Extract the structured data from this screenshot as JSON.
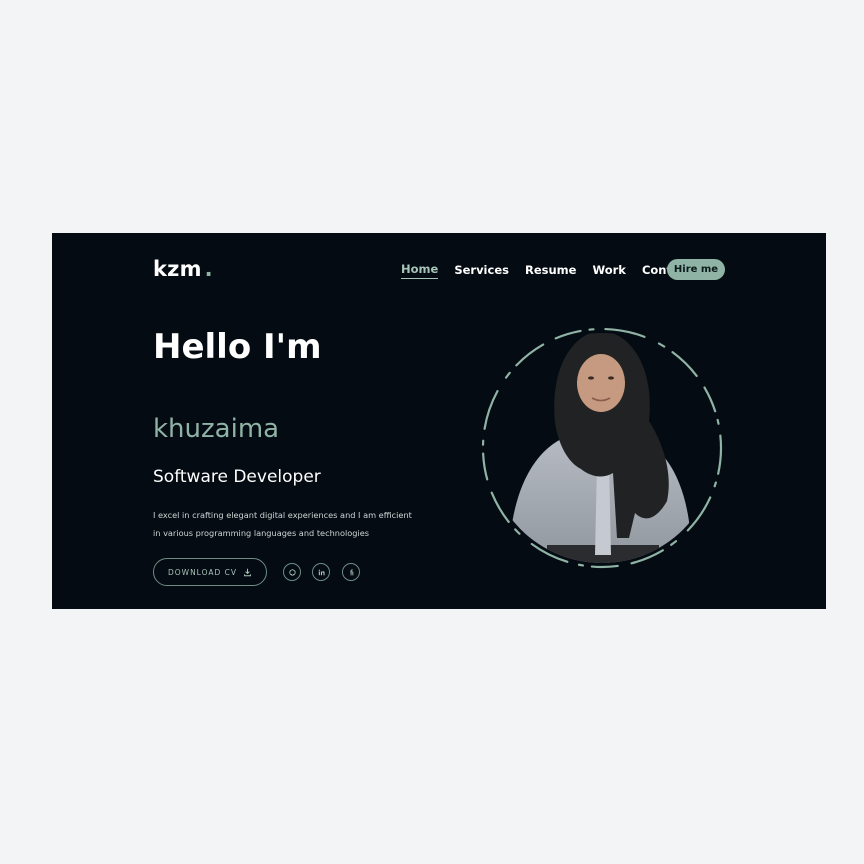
{
  "header": {
    "logo": "kzm",
    "logo_dot": ".",
    "nav": [
      "Home",
      "Services",
      "Resume",
      "Work",
      "Contact"
    ],
    "active_nav": "Home",
    "hire_label": "Hire me"
  },
  "hero": {
    "greeting": "Hello I'm",
    "name": "khuzaima",
    "role": "Software Developer",
    "description": "I excel in crafting elegant digital experiences and I am efficient in various programming languages and technologies",
    "download_label": "DOWNLOAD CV",
    "socials": [
      "github-icon",
      "linkedin-icon",
      "fiverr-icon"
    ]
  },
  "colors": {
    "background": "#040b12",
    "accent": "#8fb3a5",
    "page": "#f3f4f6"
  }
}
